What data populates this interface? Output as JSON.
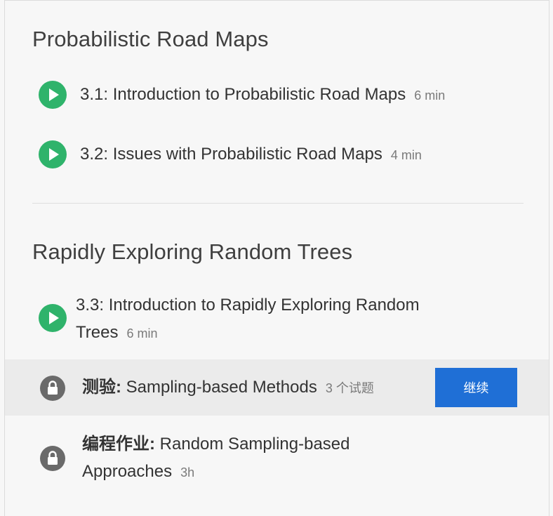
{
  "sections": [
    {
      "title": "Probabilistic Road Maps",
      "items": [
        {
          "icon": "play-icon",
          "title": "3.1: Introduction to Probabilistic Road Maps",
          "meta": "6 min"
        },
        {
          "icon": "play-icon",
          "title": "3.2: Issues with Probabilistic Road Maps",
          "meta": "4 min"
        }
      ]
    },
    {
      "title": "Rapidly Exploring Random Trees",
      "items": [
        {
          "icon": "play-icon",
          "title_line1": "3.3: Introduction to Rapidly Exploring Random",
          "title_line2": "Trees",
          "meta": "6 min"
        },
        {
          "icon": "lock-icon",
          "label": "测验:",
          "title": "Sampling-based Methods",
          "meta": "3 个试题",
          "button": "继续"
        },
        {
          "icon": "lock-icon",
          "label": "编程作业:",
          "title_line1": "Random Sampling-based",
          "title_line2": "Approaches",
          "meta": "3h"
        }
      ]
    }
  ],
  "colors": {
    "play": "#2fb36b",
    "lock": "#6a6a6a",
    "button": "#1f6fd6",
    "highlight_row": "#ebebeb"
  }
}
